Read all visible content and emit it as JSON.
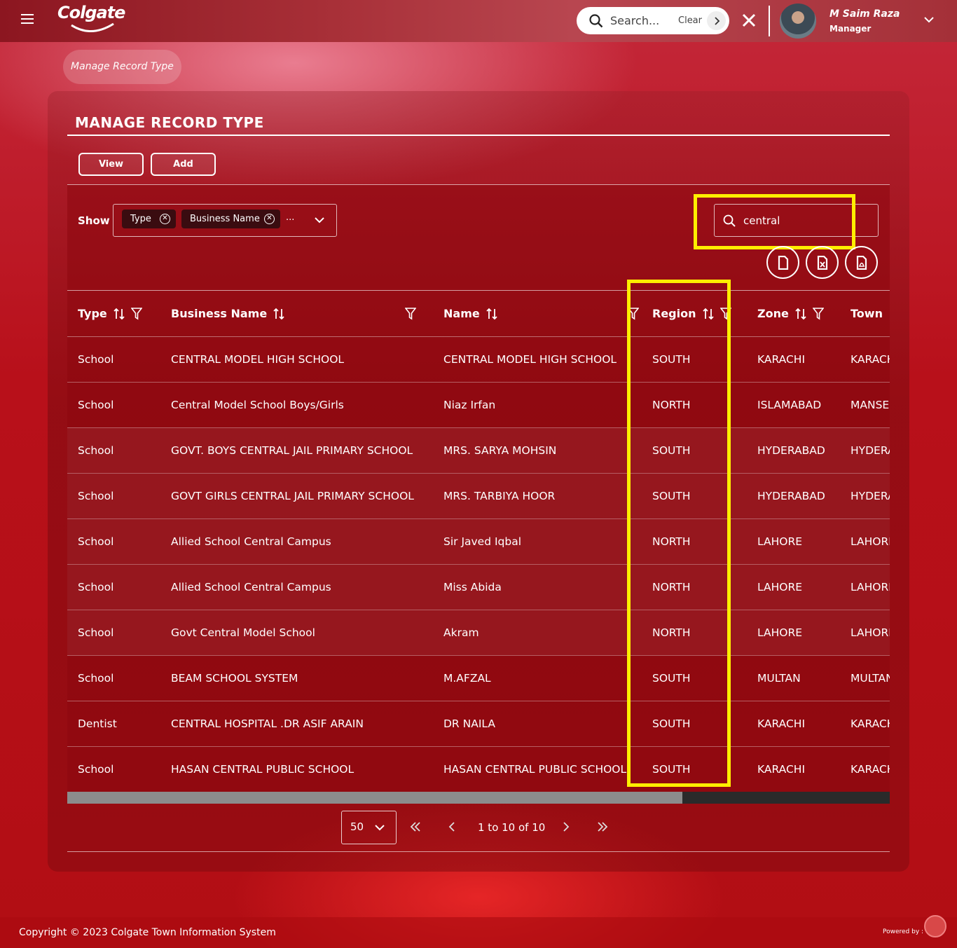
{
  "header": {
    "logo_text": "Colgate",
    "search_placeholder": "Search...",
    "clear_label": "Clear",
    "user_name": "M Saim Raza",
    "user_role": "Manager"
  },
  "breadcrumb": "Manage Record Type",
  "page_title": "MANAGE RECORD TYPE",
  "buttons": {
    "view": "View",
    "add": "Add"
  },
  "show_filter": {
    "label": "Show",
    "chips": [
      "Type",
      "Business Name"
    ],
    "more": "..."
  },
  "grid_search_value": "central",
  "columns": [
    "Type",
    "Business Name",
    "Name",
    "Region",
    "Zone",
    "Town"
  ],
  "rows": [
    [
      "School",
      "CENTRAL MODEL HIGH SCHOOL",
      "CENTRAL MODEL HIGH SCHOOL",
      "SOUTH",
      "KARACHI",
      "KARACHI"
    ],
    [
      "School",
      "Central Model School Boys/Girls",
      "Niaz Irfan",
      "NORTH",
      "ISLAMABAD",
      "MANSEHRA"
    ],
    [
      "School",
      "GOVT. BOYS CENTRAL JAIL PRIMARY SCHOOL",
      "MRS. SARYA MOHSIN",
      "SOUTH",
      "HYDERABAD",
      "HYDERABAD"
    ],
    [
      "School",
      "GOVT GIRLS CENTRAL JAIL PRIMARY SCHOOL",
      "MRS. TARBIYA HOOR",
      "SOUTH",
      "HYDERABAD",
      "HYDERABAD"
    ],
    [
      "School",
      "Allied School Central Campus",
      "Sir Javed Iqbal",
      "NORTH",
      "LAHORE",
      "LAHORE"
    ],
    [
      "School",
      "Allied School Central Campus",
      "Miss Abida",
      "NORTH",
      "LAHORE",
      "LAHORE"
    ],
    [
      "School",
      "Govt Central Model School",
      "Akram",
      "NORTH",
      "LAHORE",
      "LAHORE"
    ],
    [
      "School",
      "BEAM SCHOOL SYSTEM",
      "M.AFZAL",
      "SOUTH",
      "MULTAN",
      "MULTAN"
    ],
    [
      "Dentist",
      "CENTRAL HOSPITAL .DR ASIF ARAIN",
      "DR NAILA",
      "SOUTH",
      "KARACHI",
      "KARACHI"
    ],
    [
      "School",
      "HASAN CENTRAL PUBLIC SCHOOL",
      "HASAN CENTRAL PUBLIC SCHOOL",
      "SOUTH",
      "KARACHI",
      "KARACHI"
    ]
  ],
  "pager": {
    "page_size": "50",
    "info": "1 to 10 of 10"
  },
  "footer": {
    "copyright": "Copyright © 2023 Colgate Town Information System",
    "powered_by": "Powered by :"
  },
  "colors": {
    "highlight": "#ffee00",
    "brand_red": "#b20e14"
  }
}
